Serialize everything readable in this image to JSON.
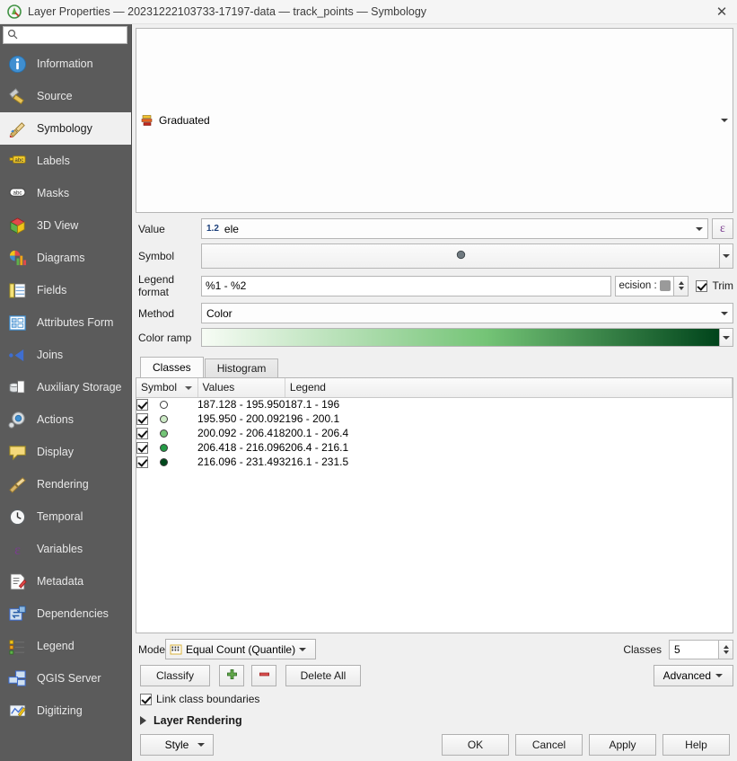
{
  "window": {
    "title": "Layer Properties — 20231222103733-17197-data — track_points — Symbology",
    "icon": "qgis-logo-icon",
    "close_label": "✕"
  },
  "sidebar": {
    "search": {
      "value": "",
      "placeholder": "",
      "icon": "search-icon"
    },
    "items": [
      {
        "label": "Information",
        "icon": "information-icon",
        "active": false
      },
      {
        "label": "Source",
        "icon": "source-icon",
        "active": false
      },
      {
        "label": "Symbology",
        "icon": "symbology-brush-icon",
        "active": true
      },
      {
        "label": "Labels",
        "icon": "labels-abc-icon",
        "active": false
      },
      {
        "label": "Masks",
        "icon": "masks-abc-icon",
        "active": false
      },
      {
        "label": "3D View",
        "icon": "3d-view-cube-icon",
        "active": false
      },
      {
        "label": "Diagrams",
        "icon": "diagrams-chart-icon",
        "active": false
      },
      {
        "label": "Fields",
        "icon": "fields-table-icon",
        "active": false
      },
      {
        "label": "Attributes Form",
        "icon": "attributes-form-icon",
        "active": false
      },
      {
        "label": "Joins",
        "icon": "joins-icon",
        "active": false
      },
      {
        "label": "Auxiliary Storage",
        "icon": "auxiliary-storage-icon",
        "active": false
      },
      {
        "label": "Actions",
        "icon": "actions-gear-icon",
        "active": false
      },
      {
        "label": "Display",
        "icon": "display-balloon-icon",
        "active": false
      },
      {
        "label": "Rendering",
        "icon": "rendering-brush-icon",
        "active": false
      },
      {
        "label": "Temporal",
        "icon": "temporal-clock-icon",
        "active": false
      },
      {
        "label": "Variables",
        "icon": "variables-epsilon-icon",
        "active": false
      },
      {
        "label": "Metadata",
        "icon": "metadata-pencil-icon",
        "active": false
      },
      {
        "label": "Dependencies",
        "icon": "dependencies-icon",
        "active": false
      },
      {
        "label": "Legend",
        "icon": "legend-icon",
        "active": false
      },
      {
        "label": "QGIS Server",
        "icon": "qgis-server-icon",
        "active": false
      },
      {
        "label": "Digitizing",
        "icon": "digitizing-icon",
        "active": false
      }
    ]
  },
  "renderer": {
    "selected": "Graduated",
    "icon": "graduated-bars-icon"
  },
  "form": {
    "value": {
      "label": "Value",
      "field_type_badge": "1.2",
      "value": "ele",
      "expression_button": "ε"
    },
    "symbol": {
      "label": "Symbol",
      "preview_color": "#707a80"
    },
    "legend_format": {
      "label": "Legend format",
      "value": "%1 - %2",
      "precision_label": "ecision :",
      "trim_label": "Trim",
      "trim_checked": true
    },
    "method": {
      "label": "Method",
      "value": "Color"
    },
    "color_ramp": {
      "label": "Color ramp",
      "name": "Greens",
      "start_color": "#f7fcf5",
      "mid_color": "#74c476",
      "end_color": "#00441b"
    }
  },
  "tabs": [
    {
      "label": "Classes",
      "active": true
    },
    {
      "label": "Histogram",
      "active": false
    }
  ],
  "table": {
    "headers": [
      "Symbol",
      "Values",
      "Legend"
    ],
    "rows": [
      {
        "checked": true,
        "color": "#ffffff",
        "values": "187.128 - 195.950",
        "legend": "187.1 - 196"
      },
      {
        "checked": true,
        "color": "#cdeac6",
        "values": "195.950 - 200.092",
        "legend": "196 - 200.1"
      },
      {
        "checked": true,
        "color": "#73c476",
        "values": "200.092 - 206.418",
        "legend": "200.1 - 206.4"
      },
      {
        "checked": true,
        "color": "#249b46",
        "values": "206.418 - 216.096",
        "legend": "206.4 - 216.1"
      },
      {
        "checked": true,
        "color": "#00481c",
        "values": "216.096 - 231.493",
        "legend": "216.1 - 231.5"
      }
    ]
  },
  "controls": {
    "mode_label": "Mode",
    "mode_value": "Equal Count (Quantile)",
    "mode_icon": "quantile-icon",
    "classes_label": "Classes",
    "classes_value": "5",
    "classify_label": "Classify",
    "add_class_icon": "plus-icon",
    "delete_class_icon": "minus-icon",
    "delete_all_label": "Delete All",
    "advanced_label": "Advanced",
    "link_class_boundaries_label": "Link class boundaries",
    "link_class_boundaries_checked": true,
    "layer_rendering_label": "Layer Rendering",
    "layer_rendering_expanded": false
  },
  "footer": {
    "style_label": "Style",
    "ok_label": "OK",
    "cancel_label": "Cancel",
    "apply_label": "Apply",
    "help_label": "Help"
  }
}
